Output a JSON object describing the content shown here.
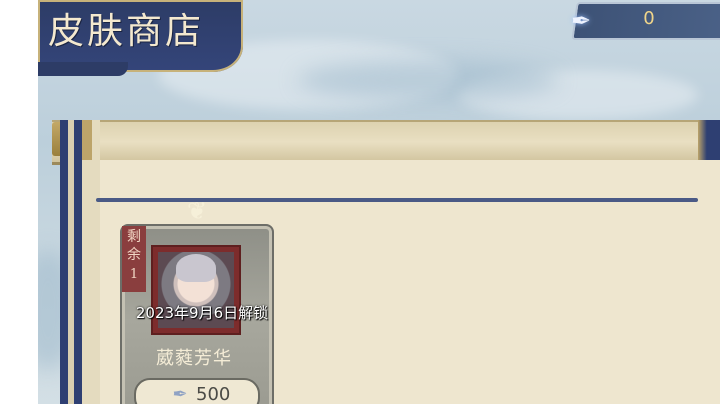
{
  "header": {
    "title": "皮肤商店"
  },
  "currency": {
    "icon": "feather-icon",
    "value": "0"
  },
  "shop": {
    "items": [
      {
        "remaining_label": "剩余",
        "remaining_count": "1",
        "unlock_text": "2023年9月6日解锁",
        "name": "葳蕤芳华",
        "price_icon": "feather-icon",
        "price": "500"
      }
    ]
  },
  "colors": {
    "banner": "#2d3c66",
    "scroll_paper": "#eee6cf",
    "tag_red": "#8a3e3e",
    "price_gold": "#f0d58a"
  }
}
